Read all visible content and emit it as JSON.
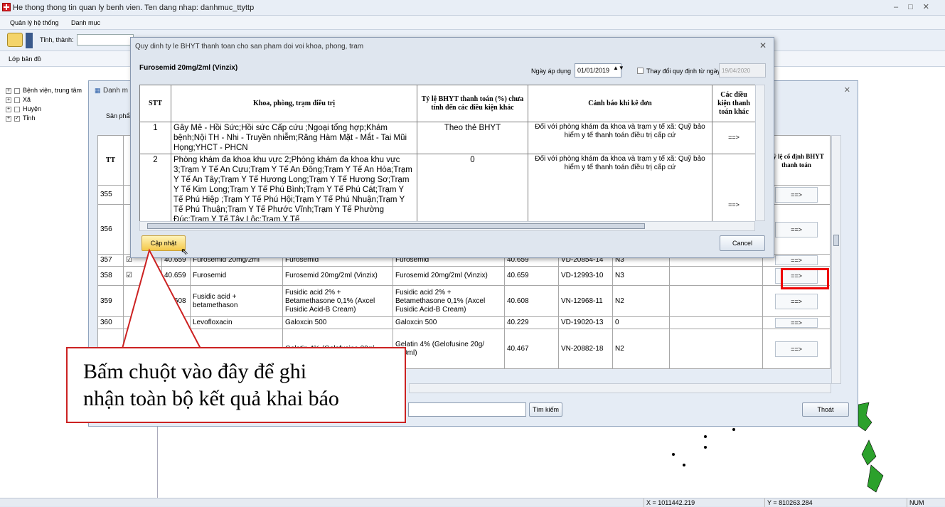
{
  "app": {
    "title": "He thong thong tin quan ly benh vien. Ten dang nhap: danhmuc_ttyttp",
    "menu": [
      "Quản lý hệ thống",
      "Danh mục"
    ],
    "toolbar": {
      "province_label": "Tỉnh, thành:"
    },
    "layer_label": "Lớp bản đồ",
    "tree": [
      {
        "label": "Bệnh viện, trung tâm",
        "checked": false
      },
      {
        "label": "Xã",
        "checked": false
      },
      {
        "label": "Huyện",
        "checked": false
      },
      {
        "label": "Tỉnh",
        "checked": true
      }
    ],
    "status": {
      "x": "X = 1011442.219",
      "y": "Y = 810263.284",
      "num": "NUM"
    }
  },
  "mainwin": {
    "title": "Danh m",
    "filter_label": "Sản phẩm",
    "col_tt": "TT",
    "col_right": "Tỷ lệ cố định BHYT thanh toán",
    "arrow": "==>",
    "rows": [
      {
        "tt": "355",
        "c1": "",
        "c2": "",
        "c3": "",
        "c4": "",
        "c5": "",
        "c6": "",
        "c7": ""
      },
      {
        "tt": "356",
        "c1": "",
        "c2": "",
        "c3": "",
        "c4": "",
        "c5": "",
        "c6": "",
        "c7": ""
      },
      {
        "tt": "357",
        "c1": "40.659",
        "c2": "Furosemid 20mg/2ml",
        "c3": "Furosemid",
        "c4": "Furosemid",
        "c5": "40.659",
        "c6": "VD-20854-14",
        "c7": "N3"
      },
      {
        "tt": "358",
        "c1": "40.659",
        "c2": "Furosemid",
        "c3": "Furosemid 20mg/2ml (Vinzix)",
        "c4": "Furosemid 20mg/2ml (Vinzix)",
        "c5": "40.659",
        "c6": "VD-12993-10",
        "c7": "N3"
      },
      {
        "tt": "359",
        "c1": "40.608",
        "c2": "Fusidic acid + betamethason",
        "c3": "Fusidic acid 2% + Betamethasone 0,1% (Axcel Fusidic Acid-B Cream)",
        "c4": "Fusidic acid 2% + Betamethasone 0,1% (Axcel Fusidic Acid-B Cream)",
        "c5": "40.608",
        "c6": "VN-12968-11",
        "c7": "N2"
      },
      {
        "tt": "360",
        "c1": "",
        "c2": "Levofloxacin",
        "c3": "Galoxcin 500",
        "c4": "Galoxcin 500",
        "c5": "40.229",
        "c6": "VD-19020-13",
        "c7": "0"
      },
      {
        "tt": "",
        "c1": "",
        "c2": "",
        "c3": "Gelatin 4% (Gelofusine 20g/",
        "c4": "Gelatin 4% (Gelofusine 20g/ 500ml)",
        "c5": "40.467",
        "c6": "VN-20882-18",
        "c7": "N2"
      }
    ],
    "search_button": "Tìm kiếm",
    "exit_button": "Thoát"
  },
  "dialog": {
    "title": "Quy dinh ty le BHYT thanh toan  cho san pham doi voi  khoa, phong, tram",
    "product": "Furosemid 20mg/2ml (Vinzix)",
    "date_label": "Ngày áp dụng",
    "date_value": "01/01/2019",
    "change_label": "Thay đổi quy định từ ngày",
    "change_date": "19/04/2020",
    "headers": {
      "stt": "STT",
      "dept": "Khoa, phòng, trạm điều trị",
      "rate": "Tỷ lệ BHYT thanh toán (%) chưa tính đến các điều kiện khác",
      "warn": "Cảnh báo khi kê đơn",
      "cond": "Các điều kiện thanh toán khác"
    },
    "rows": [
      {
        "stt": "1",
        "dept": "Gây Mê - Hồi Sức;Hồi sức Cấp cứu ;Ngoại tổng hợp;Khám bệnh;Nội TH - Nhi - Truyền nhiễm;Răng Hàm Mặt - Mắt - Tai Mũi Họng;YHCT - PHCN",
        "rate": "Theo thẻ BHYT",
        "warn": "Đối với phòng khám đa khoa và trạm y tế xã: Quỹ bảo hiểm y tế thanh toán điều trị cấp cứ",
        "cond": "==>"
      },
      {
        "stt": "2",
        "dept": "Phòng khám đa khoa khu vực 2;Phòng khám đa khoa khu vực 3;Trạm Y Tế An Cựu;Trạm Y Tế An Đông;Trạm Y Tế An Hòa;Trạm Y Tế An Tây;Trạm Y Tế Hương Long;Trạm Y Tế Hương Sơ;Trạm Y Tế Kim Long;Trạm Y Tế Phú Bình;Trạm Y Tế Phú Cát;Trạm Y Tế Phú Hiệp ;Trạm Y Tế Phú Hội;Trạm Y Tế Phú Nhuận;Trạm Y Tế Phú Thuận;Trạm Y Tế Phước Vĩnh;Trạm Y Tế Phường Đúc;Trạm Y Tế Tây Lộc;Trạm Y Tế",
        "rate": "0",
        "warn": "Đối với phòng khám đa khoa và trạm y tế xã: Quỹ bảo hiểm y tế thanh toán điều trị cấp cứ",
        "cond": "==>"
      }
    ],
    "update_button": "Cập nhật",
    "cancel_button": "Cancel"
  },
  "callout": {
    "line1": "Bấm chuột vào đây để ghi",
    "line2": "nhận toàn bộ kết quả khai báo"
  }
}
